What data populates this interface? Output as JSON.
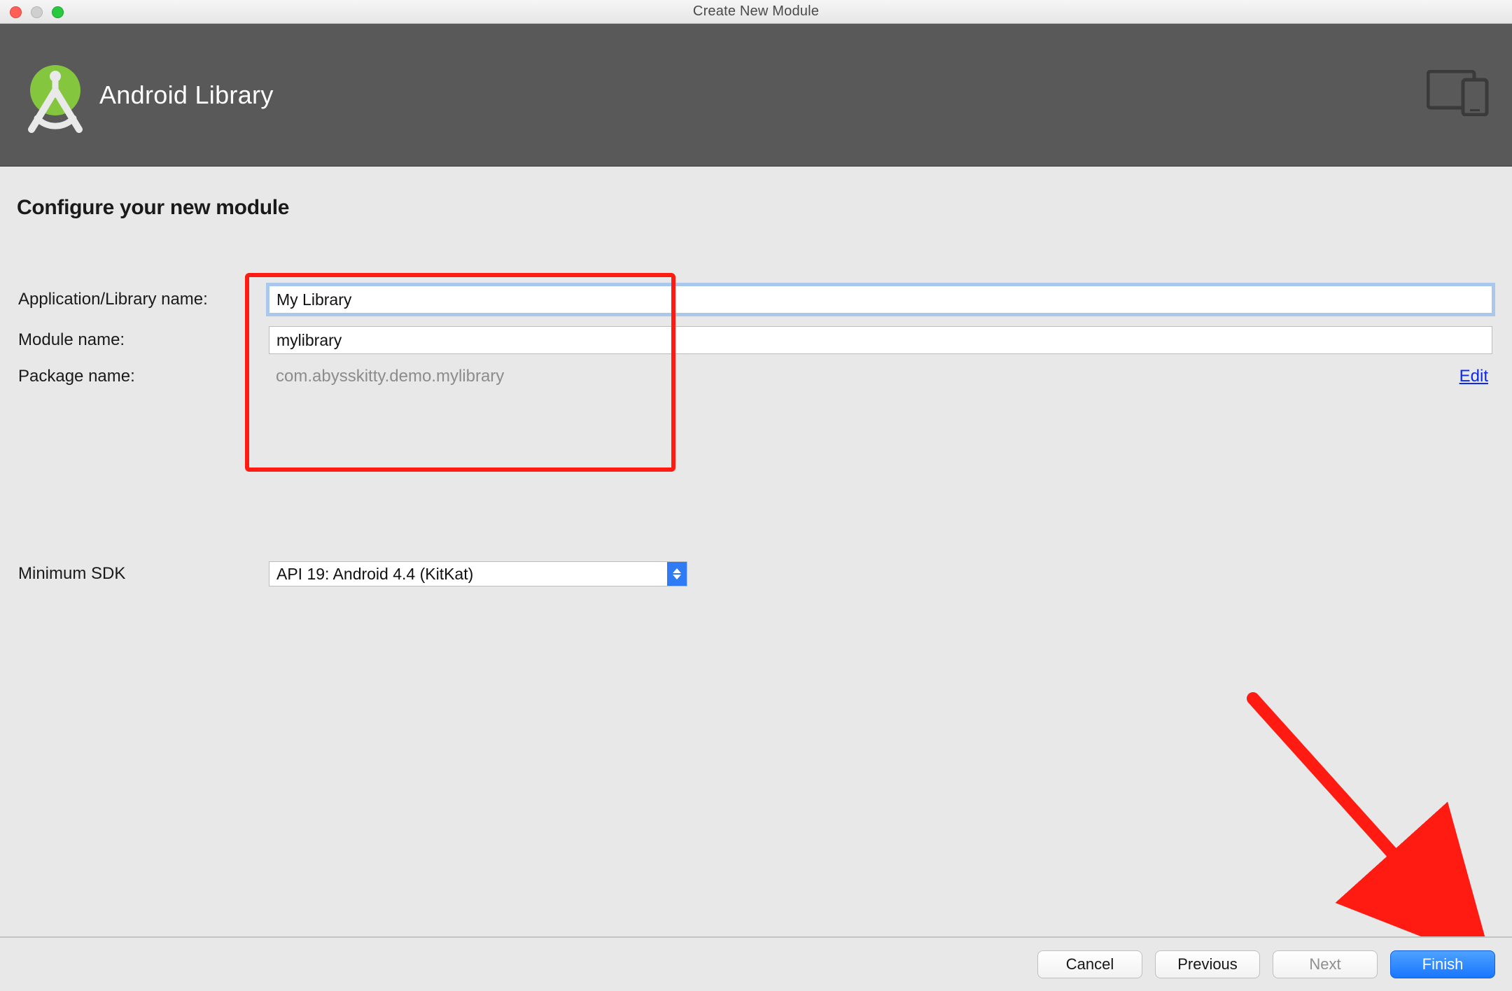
{
  "window": {
    "title": "Create New Module"
  },
  "header": {
    "title": "Android Library"
  },
  "section": {
    "title": "Configure your new module"
  },
  "form": {
    "app_name_label": "Application/Library name:",
    "app_name_value": "My Library",
    "module_name_label": "Module name:",
    "module_name_value": "mylibrary",
    "package_name_label": "Package name:",
    "package_name_value": "com.abysskitty.demo.mylibrary",
    "edit_link": "Edit",
    "sdk_label": "Minimum SDK",
    "sdk_value": "API 19: Android 4.4 (KitKat)"
  },
  "footer": {
    "cancel": "Cancel",
    "previous": "Previous",
    "next": "Next",
    "finish": "Finish"
  }
}
